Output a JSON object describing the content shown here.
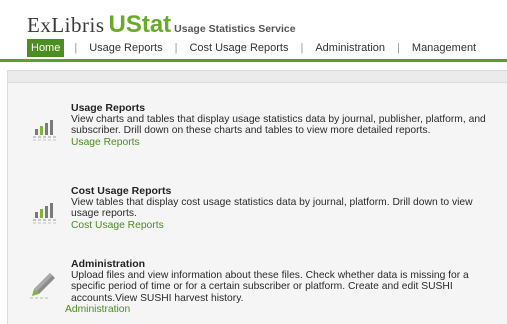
{
  "brand": {
    "exlibris": "ExLibris",
    "ustat": "UStat",
    "service": "Usage Statistics Service"
  },
  "nav": {
    "items": [
      {
        "label": "Home",
        "active": true
      },
      {
        "label": "Usage Reports"
      },
      {
        "label": "Cost Usage Reports"
      },
      {
        "label": "Administration"
      },
      {
        "label": "Management"
      }
    ],
    "separator": "|"
  },
  "sections": [
    {
      "title": "Usage Reports",
      "description": "View charts and tables that display usage statistics data by journal, publisher, platform, and subscriber. Drill down on these charts and tables to view more detailed reports.",
      "link": "Usage Reports",
      "icon": "bar-chart-icon"
    },
    {
      "title": "Cost Usage Reports",
      "description": "View tables that display cost usage statistics data by journal, platform. Drill down to view usage reports.",
      "link": "Cost Usage Reports",
      "icon": "bar-chart-icon"
    },
    {
      "title": "Administration",
      "description": "Upload files and view information about these files. Check whether data is missing for a specific period of time or for a certain subscriber or platform. Create and edit SUSHI accounts.View SUSHI harvest history.",
      "link": "Administration",
      "icon": "pencil-icon"
    }
  ],
  "colors": {
    "brand_green": "#6aaa2a",
    "nav_active": "#4a8f1f",
    "nav_line": "#5e9e2b",
    "link": "#4a8f1f"
  }
}
